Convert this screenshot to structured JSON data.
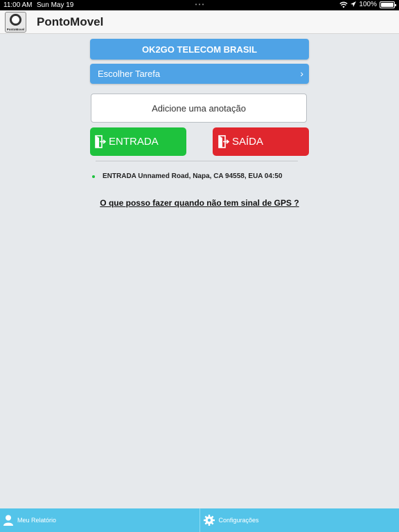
{
  "status_bar": {
    "time": "11:00 AM",
    "date": "Sun May 19",
    "battery": "100%"
  },
  "header": {
    "logo_text": "PontoMovel",
    "title": "PontoMovel"
  },
  "main": {
    "company_button": "OK2GO TELECOM BRASIL",
    "task_button": "Escolher Tarefa",
    "note_placeholder": "Adicione uma anotação",
    "entry_button": "ENTRADA",
    "exit_button": "SAÍDA",
    "records": [
      {
        "text": "ENTRADA Unnamed Road, Napa, CA 94558, EUA 04:50",
        "color": "#1ec23d"
      }
    ],
    "gps_help_link": "O que posso fazer quando não tem sinal de GPS ?"
  },
  "tab_bar": {
    "tabs": [
      {
        "label": "Meu Relatório",
        "icon": "person-icon"
      },
      {
        "label": "Configurações",
        "icon": "gear-icon"
      }
    ]
  },
  "colors": {
    "accent_blue": "#4fa3e6",
    "entry_green": "#1ec23d",
    "exit_red": "#e0262d",
    "tab_bar": "#54c4e9"
  }
}
